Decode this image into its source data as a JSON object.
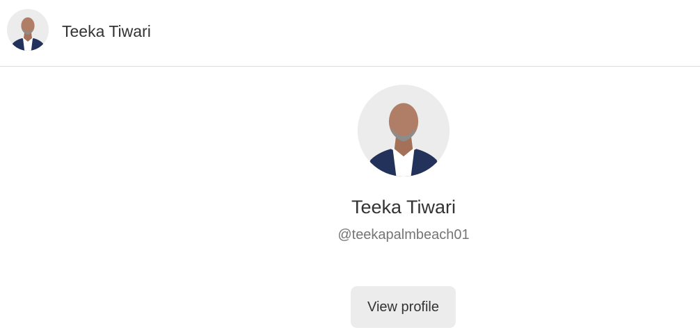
{
  "header": {
    "avatar_icon": "profile-photo",
    "name": "Teeka Tiwari"
  },
  "profile": {
    "avatar_icon": "profile-photo",
    "name": "Teeka Tiwari",
    "handle": "@teekapalmbeach01",
    "button_label": "View profile"
  },
  "colors": {
    "page_background": "#ffffff",
    "text_primary": "#333333",
    "text_secondary": "#757575",
    "button_background": "#ececec",
    "divider": "#dcdcdc",
    "suit": "#22325a",
    "skin": "#b07e66"
  }
}
